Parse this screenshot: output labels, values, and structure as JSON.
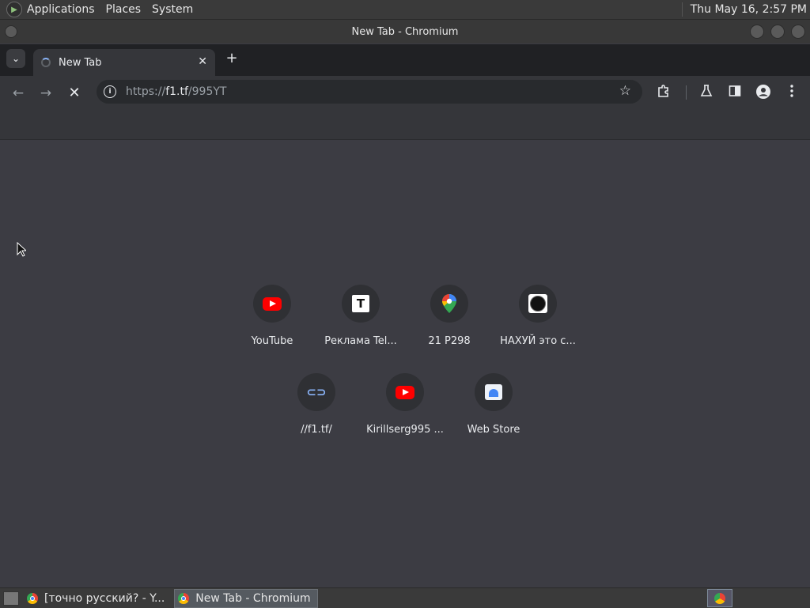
{
  "top_panel": {
    "menus": [
      "Applications",
      "Places",
      "System"
    ],
    "clock": "Thu May 16,  2:57 PM"
  },
  "window": {
    "title": "New Tab - Chromium"
  },
  "tabs": [
    {
      "label": "New Tab",
      "loading": true
    }
  ],
  "toolbar": {
    "url_scheme": "https://",
    "url_host": "f1.tf",
    "url_path": "/995YT"
  },
  "shortcuts": [
    {
      "label": "YouTube",
      "icon": "youtube-icon"
    },
    {
      "label": "Реклама Tel...",
      "icon": "telegram-ads-icon"
    },
    {
      "label": "21 P298",
      "icon": "maps-pin-icon"
    },
    {
      "label": "НАХУЙ это с...",
      "icon": "dark-circle-icon"
    },
    {
      "label": "//f1.tf/",
      "icon": "link-icon"
    },
    {
      "label": "Kirillserg995 ...",
      "icon": "youtube-icon"
    },
    {
      "label": "Web Store",
      "icon": "web-store-icon"
    }
  ],
  "taskbar": {
    "tasks": [
      {
        "label": "[точно русский? - Y..."
      },
      {
        "label": "New Tab - Chromium"
      }
    ]
  },
  "colors": {
    "page_bg": "#3c3c43",
    "toolbar_bg": "#35363a",
    "tabstrip_bg": "#202124",
    "youtube_red": "#ff0000"
  }
}
